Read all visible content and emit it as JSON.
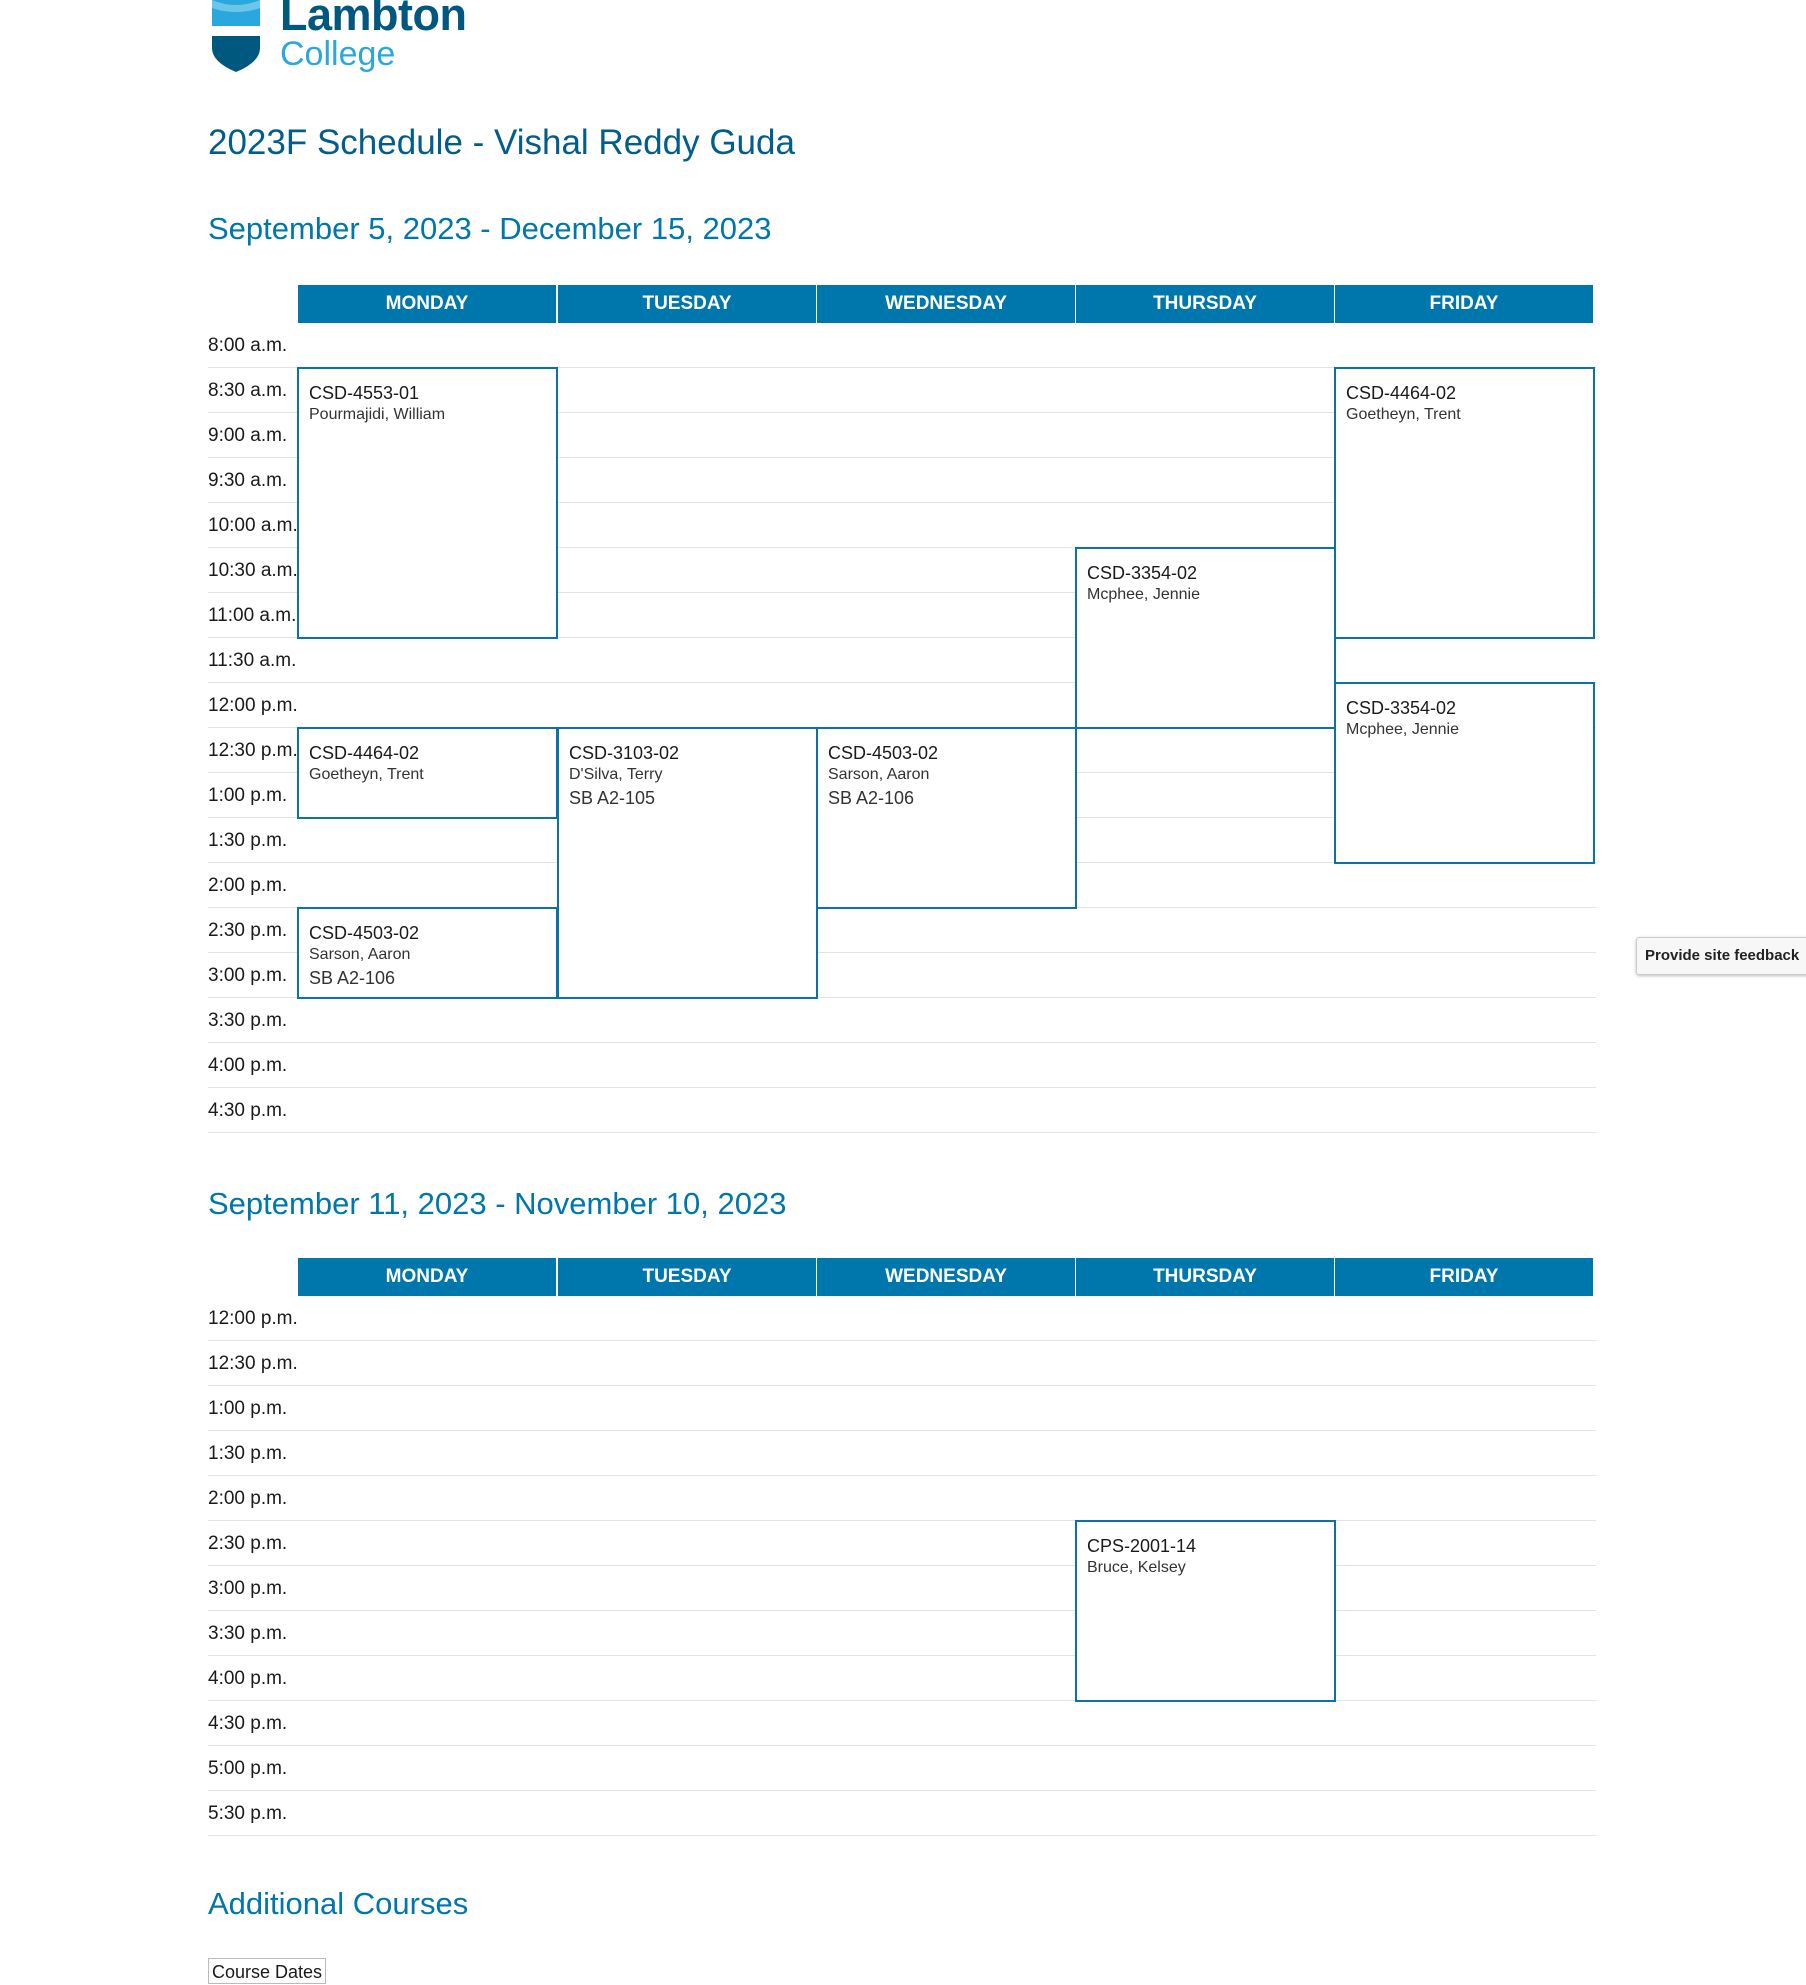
{
  "logo": {
    "line1": "Lambton",
    "line2": "College"
  },
  "page_title": "2023F Schedule - Vishal Reddy Guda",
  "days": [
    "MONDAY",
    "TUESDAY",
    "WEDNESDAY",
    "THURSDAY",
    "FRIDAY"
  ],
  "schedules": [
    {
      "heading": "September 5, 2023 - December 15, 2023",
      "times": [
        "8:00 a.m.",
        "8:30 a.m.",
        "9:00 a.m.",
        "9:30 a.m.",
        "10:00 a.m.",
        "10:30 a.m.",
        "11:00 a.m.",
        "11:30 a.m.",
        "12:00 p.m.",
        "12:30 p.m.",
        "1:00 p.m.",
        "1:30 p.m.",
        "2:00 p.m.",
        "2:30 p.m.",
        "3:00 p.m.",
        "3:30 p.m.",
        "4:00 p.m.",
        "4:30 p.m."
      ],
      "events": [
        {
          "day": "MONDAY",
          "start": "8:30 a.m.",
          "end": "11:30 a.m.",
          "code": "CSD-4553-01",
          "instructor": "Pourmajidi, William",
          "room": ""
        },
        {
          "day": "FRIDAY",
          "start": "8:30 a.m.",
          "end": "11:30 a.m.",
          "code": "CSD-4464-02",
          "instructor": "Goetheyn, Trent",
          "room": ""
        },
        {
          "day": "THURSDAY",
          "start": "10:30 a.m.",
          "end": "12:30 p.m.",
          "code": "CSD-3354-02",
          "instructor": "Mcphee, Jennie",
          "room": ""
        },
        {
          "day": "FRIDAY",
          "start": "12:00 p.m.",
          "end": "2:00 p.m.",
          "code": "CSD-3354-02",
          "instructor": "Mcphee, Jennie",
          "room": ""
        },
        {
          "day": "MONDAY",
          "start": "12:30 p.m.",
          "end": "1:30 p.m.",
          "code": "CSD-4464-02",
          "instructor": "Goetheyn, Trent",
          "room": ""
        },
        {
          "day": "TUESDAY",
          "start": "12:30 p.m.",
          "end": "3:30 p.m.",
          "code": "CSD-3103-02",
          "instructor": "D'Silva, Terry",
          "room": "SB A2-105"
        },
        {
          "day": "WEDNESDAY",
          "start": "12:30 p.m.",
          "end": "2:30 p.m.",
          "code": "CSD-4503-02",
          "instructor": "Sarson, Aaron",
          "room": "SB A2-106"
        },
        {
          "day": "MONDAY",
          "start": "2:30 p.m.",
          "end": "3:30 p.m.",
          "code": "CSD-4503-02",
          "instructor": "Sarson, Aaron",
          "room": "SB A2-106"
        }
      ]
    },
    {
      "heading": "September 11, 2023 - November 10, 2023",
      "times": [
        "12:00 p.m.",
        "12:30 p.m.",
        "1:00 p.m.",
        "1:30 p.m.",
        "2:00 p.m.",
        "2:30 p.m.",
        "3:00 p.m.",
        "3:30 p.m.",
        "4:00 p.m.",
        "4:30 p.m.",
        "5:00 p.m.",
        "5:30 p.m."
      ],
      "events": [
        {
          "day": "THURSDAY",
          "start": "2:30 p.m.",
          "end": "4:30 p.m.",
          "code": "CPS-2001-14",
          "instructor": "Bruce, Kelsey",
          "room": ""
        }
      ]
    }
  ],
  "additional_courses_heading": "Additional Courses",
  "course_dates_label": "Course Dates",
  "feedback_label": "Provide site feedback",
  "colors": {
    "primary": "#0077ac",
    "heading": "#005d8d",
    "event_border": "#0b72a9",
    "logo_light": "#2aa8de"
  }
}
